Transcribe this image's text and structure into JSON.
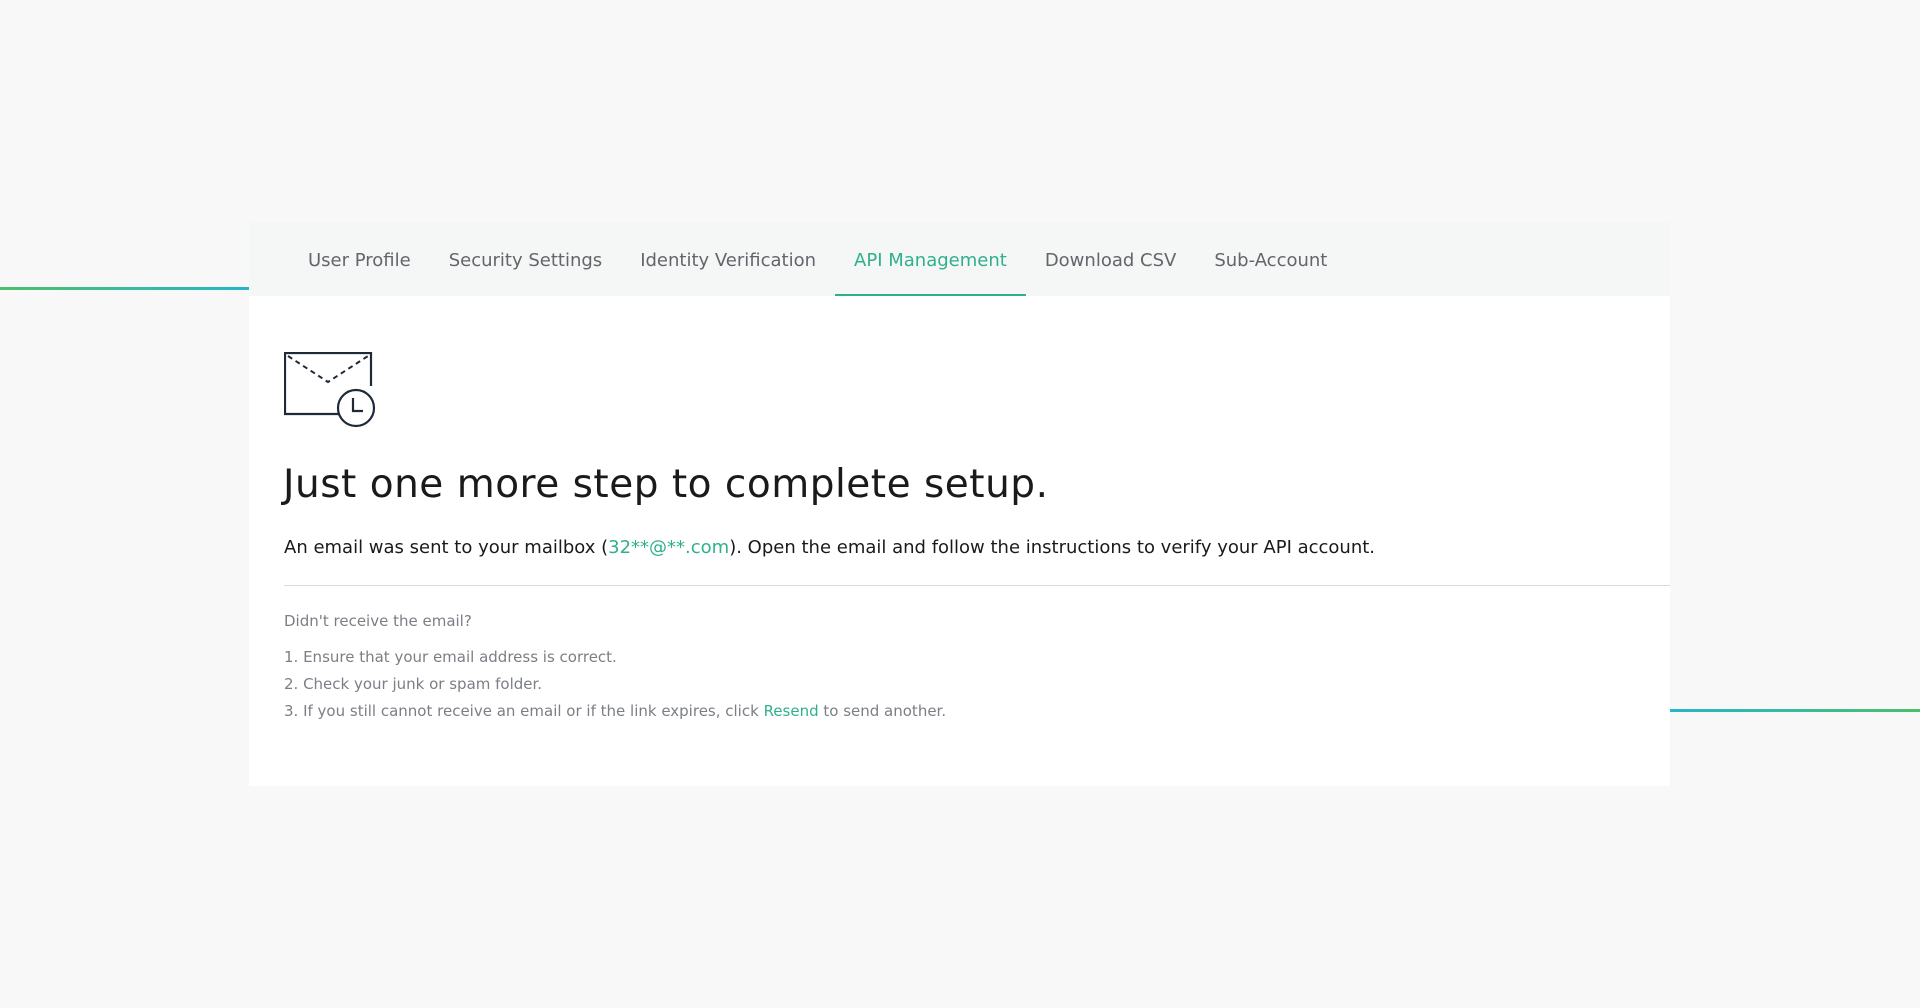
{
  "tabs": [
    {
      "label": "User Profile",
      "active": false
    },
    {
      "label": "Security Settings",
      "active": false
    },
    {
      "label": "Identity Verification",
      "active": false
    },
    {
      "label": "API Management",
      "active": true
    },
    {
      "label": "Download CSV",
      "active": false
    },
    {
      "label": "Sub-Account",
      "active": false
    }
  ],
  "icon": "mail-pending-icon",
  "headline": "Just one more step to complete setup.",
  "description": {
    "before": "An email was sent to your mailbox (",
    "email": "32**@**.com",
    "after": "). Open the email and follow the instructions to verify your API account."
  },
  "help": {
    "question": "Didn't receive the email?",
    "step1": "1. Ensure that your email address is correct.",
    "step2": "2. Check your junk or spam folder.",
    "step3_before": "3. If you still cannot receive an email or if the link expires, click ",
    "resend_label": "Resend",
    "step3_after": " to send another."
  },
  "colors": {
    "accent": "#2fb08c",
    "gradient_green": "#4cbf6b",
    "gradient_cyan": "#26b6c9"
  }
}
